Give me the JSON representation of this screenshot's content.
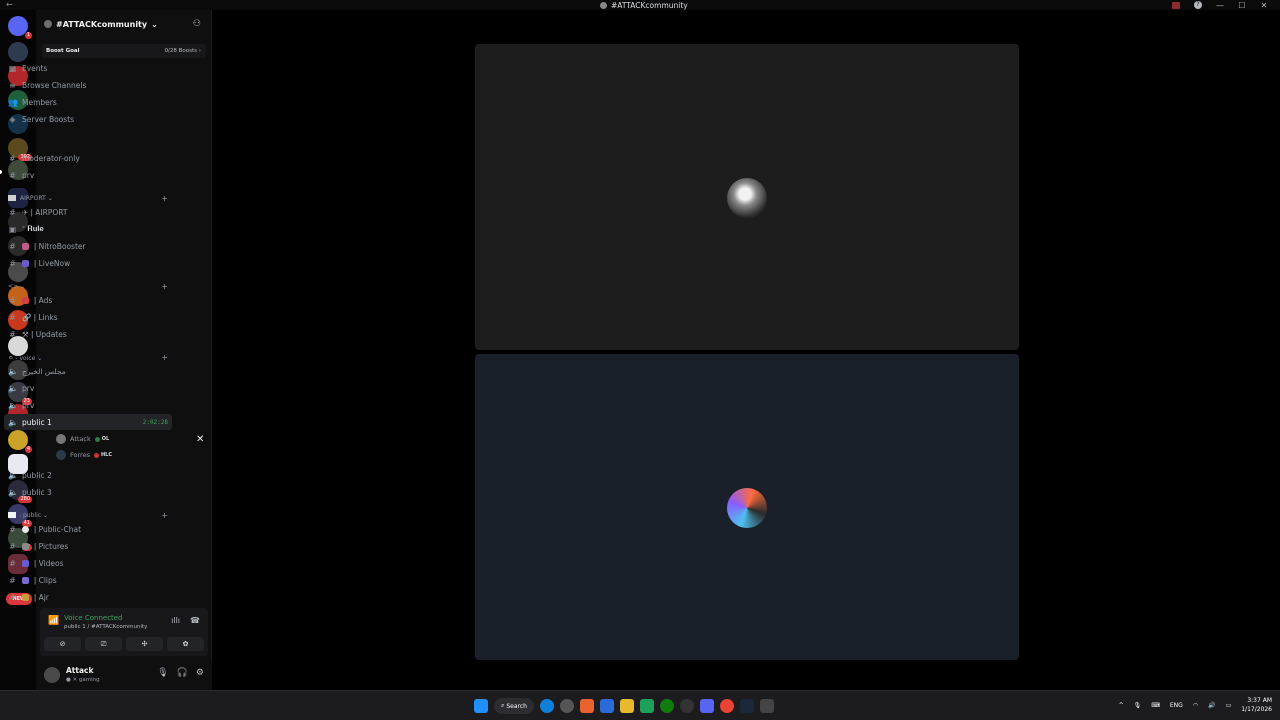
{
  "window": {
    "title": "#ATTACKcommunity",
    "back_glyph": "←",
    "controls": [
      "—",
      "☐",
      "✕"
    ]
  },
  "server": {
    "name": "#ATTACKcommunity",
    "chevron": "⌄",
    "boost_goal_label": "Boost Goal",
    "boost_goal_value": "0/28 Boosts ›"
  },
  "rail": {
    "badges": [
      "1",
      "392",
      "23",
      "59",
      "4",
      "280",
      "41",
      "87"
    ],
    "new_label": "NEW"
  },
  "menu": [
    {
      "icon": "calendar-icon",
      "glyph": "▦",
      "label": "Events"
    },
    {
      "icon": "browse-icon",
      "glyph": "≡",
      "label": "Browse Channels"
    },
    {
      "icon": "members-icon",
      "glyph": "👥",
      "label": "Members"
    },
    {
      "icon": "boost-icon",
      "glyph": "◈",
      "label": "Server Boosts"
    }
  ],
  "channels_top": [
    {
      "label": "moderator-only"
    },
    {
      "label": "prv"
    }
  ],
  "categories": {
    "airport": {
      "label": "AIRPORT ⌄"
    },
    "symbols": {
      "label": "<> ⌄"
    },
    "voice": {
      "label": "ㅇ - voice ⌄"
    },
    "public": {
      "label": "ᵢ public ⌄"
    }
  },
  "airport_channels": [
    {
      "glyph": "#",
      "label": "✈ ǀ AIRPORT"
    },
    {
      "glyph": "▣",
      "label": "ᐨ 𝐑𝐮𝐥𝐞"
    },
    {
      "glyph": "#",
      "label": "ǀ NitroBooster"
    },
    {
      "glyph": "#",
      "label": "ǀ LiveNow"
    }
  ],
  "sym_channels": [
    {
      "glyph": "#",
      "label": "ǀ Ads"
    },
    {
      "glyph": "#",
      "label": "🔗 ǀ Links"
    },
    {
      "glyph": "#",
      "label": "⚒ ǀ Updates"
    }
  ],
  "voice_channels": [
    {
      "label": "مجلس الخيرج"
    },
    {
      "label": "prv"
    },
    {
      "label": "prv"
    },
    {
      "label": "public 1",
      "timer": "2:02:28"
    },
    {
      "label": "public 2"
    },
    {
      "label": "public 3"
    }
  ],
  "voice_users": [
    {
      "name": "Attack",
      "tag": "OL"
    },
    {
      "name": "Forres",
      "tag": "HLC"
    }
  ],
  "public_channels": [
    {
      "glyph": "#",
      "label": "ǀ Public-Chat"
    },
    {
      "glyph": "#",
      "label": "ǀ Pictures"
    },
    {
      "glyph": "#",
      "label": "ǀ Videos"
    },
    {
      "glyph": "#",
      "label": "ǀ Clips"
    },
    {
      "glyph": "#",
      "label": "ǀ Ajr"
    }
  ],
  "voice_panel": {
    "status": "Voice Connected",
    "location": "public 1 / #ATTACKcommunity",
    "buttons": [
      "⊘",
      "⎚",
      "✣",
      "✿"
    ]
  },
  "user": {
    "name": "Attack",
    "status": "● ✕ gaming"
  },
  "taskbar": {
    "search_label": "Search",
    "lang": "ENG",
    "time": "3:37 AM",
    "date": "1/17/2026"
  },
  "colors": {
    "voice_green": "#3ba55c",
    "badge_red": "#da373c",
    "tile_dark": "#1d1d1d",
    "tile_blue": "#1a202a"
  }
}
